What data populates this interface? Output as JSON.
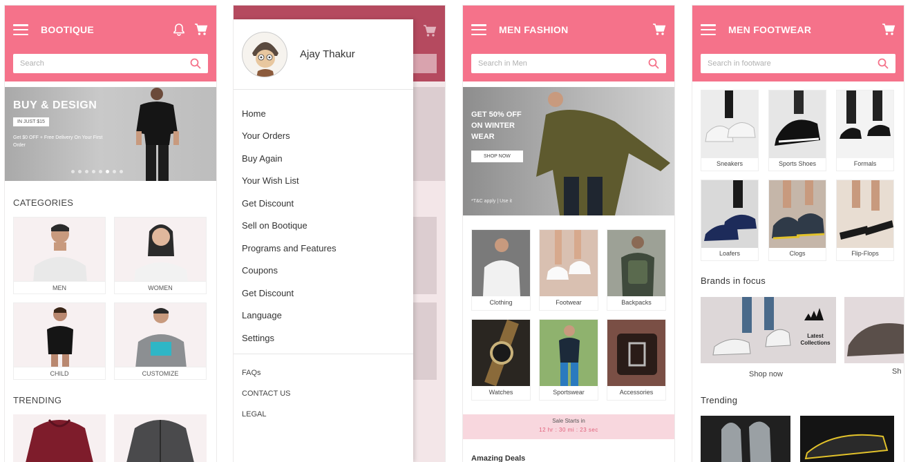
{
  "screen_home": {
    "title": "BOOTIQUE",
    "search_placeholder": "Search",
    "hero": {
      "title": "BUY & DESIGN",
      "tag": "IN JUST $15",
      "subtitle": "Get $0 OFF + Free Delivery On Your First Order"
    },
    "categories_title": "CATEGORIES",
    "categories": [
      "MEN",
      "WOMEN",
      "CHILD",
      "CUSTOMIZE"
    ],
    "trending_title": "TRENDING"
  },
  "screen_drawer": {
    "user_name": "Ajay Thakur",
    "menu": [
      "Home",
      "Your Orders",
      "Buy Again",
      "Your Wish List",
      "Get Discount",
      "Sell on Bootique",
      "Programs and Features",
      "Coupons",
      "Get Discount",
      "Language",
      "Settings"
    ],
    "menu_secondary": [
      "FAQs",
      "CONTACT US",
      "LEGAL"
    ]
  },
  "screen_men": {
    "title": "MEN FASHION",
    "search_placeholder": "Search in Men",
    "hero": {
      "title": "GET 50% OFF ON WINTER WEAR",
      "button": "SHOP NOW",
      "footnote": "*T&C apply | Use it"
    },
    "tiles": [
      "Clothing",
      "Footwear",
      "Backpacks",
      "Watches",
      "Sportswear",
      "Accessories"
    ],
    "sale_line1": "Sale Starts in",
    "sale_line2": "12 hr : 30 mi : 23 sec",
    "deals_title": "Amazing Deals"
  },
  "screen_footwear": {
    "title": "MEN FOOTWEAR",
    "search_placeholder": "Search in footware",
    "tiles": [
      "Sneakers",
      "Sports Shoes",
      "Formals",
      "Loafers",
      "Clogs",
      "Flip-Flops"
    ],
    "brands_title": "Brands in focus",
    "brand_text": "Latest Collections",
    "shop_now": "Shop now",
    "shop_now_partial": "Sh",
    "trending_title": "Trending"
  },
  "colors": {
    "accent": "#f5728a",
    "sale_strip": "#f8d7de"
  }
}
